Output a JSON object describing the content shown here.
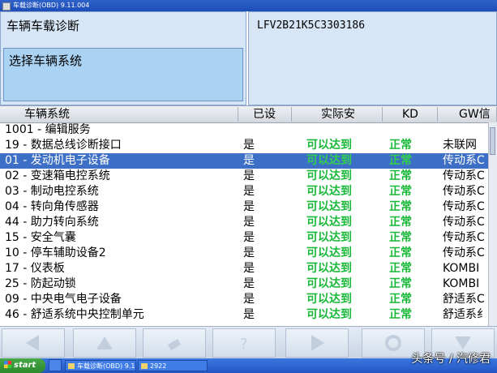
{
  "window": {
    "title": "车载诊断(OBD) 9.11.004"
  },
  "header": {
    "section_title": "车辆车载诊断",
    "vin": "LFV2B21K5C3303186",
    "select_label": "选择车辆系统"
  },
  "table": {
    "columns": [
      "车辆系统",
      "已设",
      "实际安",
      "KD",
      "GW信"
    ],
    "rows": [
      {
        "name": "1001 - 编辑服务",
        "set": "",
        "actual": "",
        "kd": "",
        "gw": ""
      },
      {
        "name": "19 - 数据总线诊断接口",
        "set": "是",
        "actual": "可以达到",
        "kd": "正常",
        "gw": "未联网"
      },
      {
        "name": "01 - 发动机电子设备",
        "set": "是",
        "actual": "可以达到",
        "kd": "正常",
        "gw": "传动系C"
      },
      {
        "name": "02 - 变速箱电控系统",
        "set": "是",
        "actual": "可以达到",
        "kd": "正常",
        "gw": "传动系C"
      },
      {
        "name": "03 - 制动电控系统",
        "set": "是",
        "actual": "可以达到",
        "kd": "正常",
        "gw": "传动系C"
      },
      {
        "name": "04 - 转向角传感器",
        "set": "是",
        "actual": "可以达到",
        "kd": "正常",
        "gw": "传动系C"
      },
      {
        "name": "44 - 助力转向系统",
        "set": "是",
        "actual": "可以达到",
        "kd": "正常",
        "gw": "传动系C"
      },
      {
        "name": "15 - 安全气囊",
        "set": "是",
        "actual": "可以达到",
        "kd": "正常",
        "gw": "传动系C"
      },
      {
        "name": "10 - 停车辅助设备2",
        "set": "是",
        "actual": "可以达到",
        "kd": "正常",
        "gw": "传动系C"
      },
      {
        "name": "17 - 仪表板",
        "set": "是",
        "actual": "可以达到",
        "kd": "正常",
        "gw": "KOMBI"
      },
      {
        "name": "25 - 防起动锁",
        "set": "是",
        "actual": "可以达到",
        "kd": "正常",
        "gw": "KOMBI"
      },
      {
        "name": "09 - 中央电气电子设备",
        "set": "是",
        "actual": "可以达到",
        "kd": "正常",
        "gw": "舒适系C"
      },
      {
        "name": "46 - 舒适系统中央控制单元",
        "set": "是",
        "actual": "可以达到",
        "kd": "正常",
        "gw": "舒适系纟"
      }
    ],
    "selected_row": 2
  },
  "toolbar": {
    "buttons": [
      "arrow-left-icon",
      "arrow-up-icon",
      "eraser-icon",
      "help-icon",
      "arrow-right-icon",
      "refresh-icon",
      "arrow-down-icon"
    ]
  },
  "taskbar": {
    "start_label": "start",
    "tasks": [
      "车载诊断(OBD) 9.1...",
      "2922"
    ]
  },
  "watermark": "头条号 / 汽修君",
  "colors": {
    "accent": "#3c6fc5",
    "status_ok": "#18b838",
    "panel": "#d7e6f7"
  }
}
